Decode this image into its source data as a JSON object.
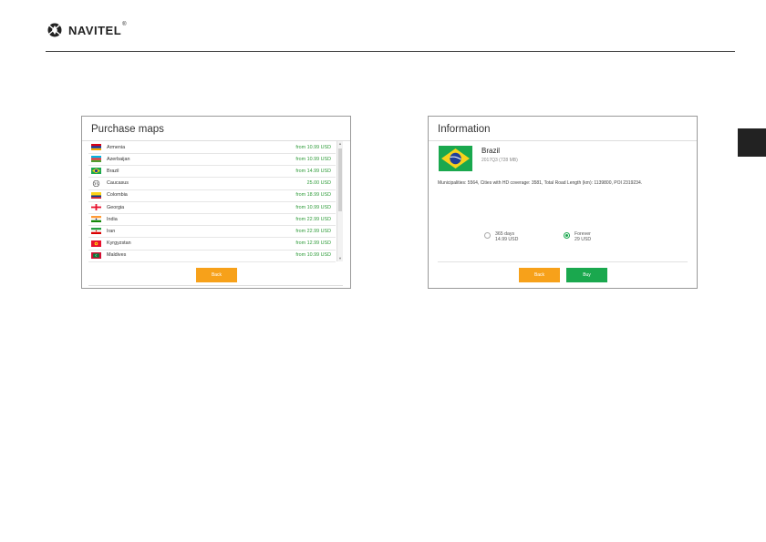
{
  "brand": {
    "name": "NAVITEL",
    "reg_mark": "®"
  },
  "purchase_panel": {
    "title": "Purchase maps",
    "maps": [
      {
        "name": "Armenia",
        "price": "from 10.99 USD",
        "flag": "armenia"
      },
      {
        "name": "Azerbaijan",
        "price": "from 10.99 USD",
        "flag": "azerbaijan"
      },
      {
        "name": "Brazil",
        "price": "from 14.99 USD",
        "flag": "brazil"
      },
      {
        "name": "Caucasus",
        "price": "25.00 USD",
        "flag": "globe"
      },
      {
        "name": "Colombia",
        "price": "from 18.99 USD",
        "flag": "colombia"
      },
      {
        "name": "Georgia",
        "price": "from 10.99 USD",
        "flag": "georgia"
      },
      {
        "name": "India",
        "price": "from 22.99 USD",
        "flag": "india"
      },
      {
        "name": "Iran",
        "price": "from 22.99 USD",
        "flag": "iran"
      },
      {
        "name": "Kyrgyzstan",
        "price": "from 12.99 USD",
        "flag": "kyrgyzstan"
      },
      {
        "name": "Maldives",
        "price": "from 10.99 USD",
        "flag": "maldives"
      }
    ],
    "back_label": "Back"
  },
  "info_panel": {
    "title": "Information",
    "country": "Brazil",
    "version": "2017Q3 (728 MB)",
    "stats": "Municipalities: 5564, Cities with HD coverage: 3581, Total Road Length (km): 1139800, POI 2319234.",
    "options": [
      {
        "label": "365 days",
        "price": "14.99 USD",
        "selected": false
      },
      {
        "label": "Forever",
        "price": "29 USD",
        "selected": true
      }
    ],
    "back_label": "Back",
    "buy_label": "Buy"
  },
  "colors": {
    "price_green": "#2e9b39",
    "button_orange": "#f7a11a",
    "button_green": "#1aa84e"
  }
}
